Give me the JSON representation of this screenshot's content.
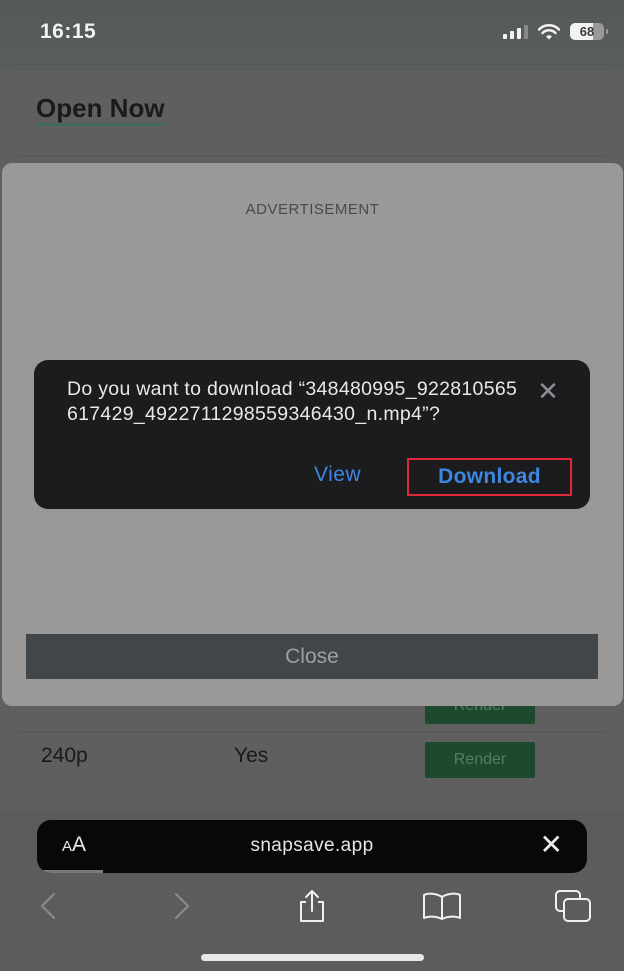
{
  "status_bar": {
    "time": "16:15",
    "battery": "68",
    "icons": [
      "cellular-signal-icon",
      "wifi-icon",
      "battery-icon"
    ]
  },
  "page": {
    "open_now_link": "Open Now",
    "table_rows": [
      {
        "resolution": "",
        "audio": "",
        "action": "Render"
      },
      {
        "resolution": "240p",
        "audio": "Yes",
        "action": "Render"
      }
    ]
  },
  "ad_modal": {
    "label": "ADVERTISEMENT",
    "close_label": "Close"
  },
  "download_alert": {
    "message": "Do you want to download “348480995_922810565617429_4922711298559346430_n.mp4”?",
    "view_label": "View",
    "download_label": "Download",
    "highlight_color": "#e0283a",
    "link_color": "#3d87e0"
  },
  "browser": {
    "text_size_small": "A",
    "text_size_big": "A",
    "url": "snapsave.app",
    "load_progress": 0.12,
    "toolbar": [
      "back-icon",
      "forward-icon",
      "share-icon",
      "bookmarks-icon",
      "tabs-icon"
    ]
  }
}
